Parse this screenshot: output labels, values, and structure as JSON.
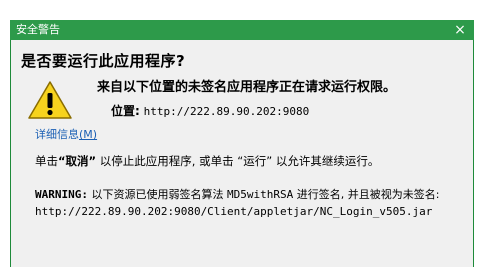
{
  "window": {
    "title": "安全警告",
    "close_glyph": "×"
  },
  "dialog": {
    "heading": "是否要运行此应用程序?",
    "main_message": "来自以下位置的未签名应用程序正在请求运行权限。",
    "location_label": "位置:",
    "location_value": "http://222.89.90.202:9080",
    "details_link_text": "详细信息",
    "details_link_accel": "(M)",
    "instruction_prefix": "单击",
    "instruction_cancel": "“取消”",
    "instruction_middle": "以停止此应用程序, 或单击",
    "instruction_run": "“运行”",
    "instruction_suffix": "以允许其继续运行。",
    "warning_label": "WARNING:",
    "warning_part1": "以下资源已使用弱签名算法",
    "warning_algo": "MD5withRSA",
    "warning_part2": "进行签名, 并且被视为未签名:",
    "warning_url": "http://222.89.90.202:9080/Client/appletjar/NC_Login_v505.jar"
  },
  "colors": {
    "titlebar": "#2d9a4a",
    "link": "#1a5fb4",
    "warning_yellow": "#f7d31e"
  },
  "icons": {
    "warning": "warning-triangle-icon",
    "close": "close-icon"
  }
}
